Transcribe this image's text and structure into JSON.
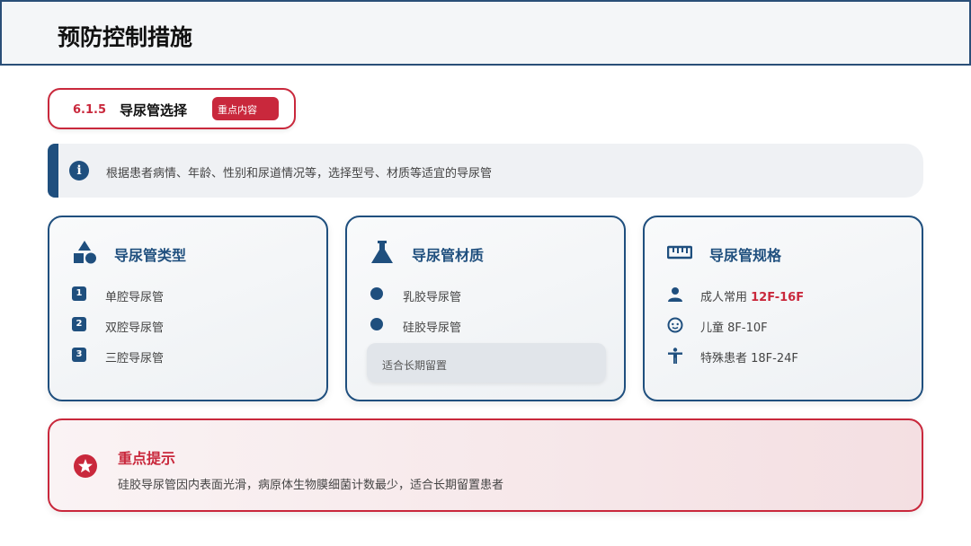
{
  "header": {
    "title": "预防控制措施"
  },
  "section": {
    "number": "6.1.5",
    "title": "导尿管选择",
    "badge": "重点内容"
  },
  "info": {
    "icon": "info-icon",
    "text": "根据患者病情、年龄、性别和尿道情况等，选择型号、材质等适宜的导尿管"
  },
  "cards": [
    {
      "title": "导尿管类型",
      "icon": "shapes-icon",
      "items": [
        {
          "icon": "number-1-icon",
          "marker": "1",
          "text": "单腔导尿管"
        },
        {
          "icon": "number-2-icon",
          "marker": "2",
          "text": "双腔导尿管"
        },
        {
          "icon": "number-3-icon",
          "marker": "3",
          "text": "三腔导尿管"
        }
      ]
    },
    {
      "title": "导尿管材质",
      "icon": "flask-icon",
      "items": [
        {
          "icon": "circle-icon",
          "text": "乳胶导尿管"
        },
        {
          "icon": "circle-icon",
          "text": "硅胶导尿管"
        }
      ],
      "note": "适合长期留置"
    },
    {
      "title": "导尿管规格",
      "icon": "ruler-icon",
      "items": [
        {
          "icon": "user-icon",
          "text": "成人常用 ",
          "highlight": "12F-16F"
        },
        {
          "icon": "child-face-icon",
          "text": "儿童 8F-10F"
        },
        {
          "icon": "accessibility-icon",
          "text": "特殊患者 18F-24F"
        }
      ]
    }
  ],
  "alert": {
    "icon": "star-icon",
    "title": "重点提示",
    "text": "硅胶导尿管因内表面光滑，病原体生物膜细菌计数最少，适合长期留置患者"
  },
  "colors": {
    "primary": "#1f4f7e",
    "accent": "#c9283c"
  }
}
